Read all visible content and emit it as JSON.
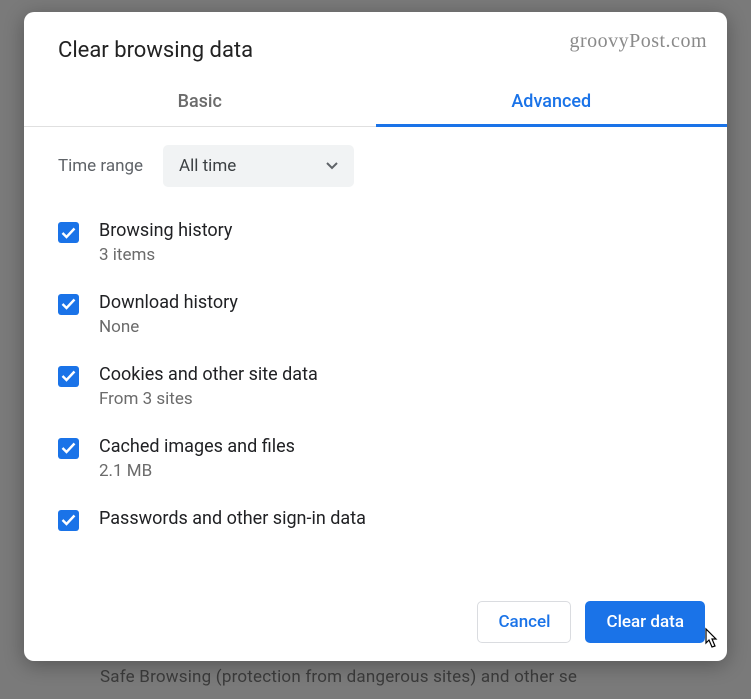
{
  "watermark": "groovyPost.com",
  "backdrop_text": "Safe Browsing (protection from dangerous sites) and other se",
  "dialog": {
    "title": "Clear browsing data",
    "tabs": {
      "basic": "Basic",
      "advanced": "Advanced",
      "active": "advanced"
    },
    "time_range": {
      "label": "Time range",
      "value": "All time"
    },
    "items": [
      {
        "title": "Browsing history",
        "subtitle": "3 items",
        "checked": true
      },
      {
        "title": "Download history",
        "subtitle": "None",
        "checked": true
      },
      {
        "title": "Cookies and other site data",
        "subtitle": "From 3 sites",
        "checked": true
      },
      {
        "title": "Cached images and files",
        "subtitle": "2.1 MB",
        "checked": true
      },
      {
        "title": "Passwords and other sign-in data",
        "subtitle": "",
        "checked": true
      }
    ],
    "buttons": {
      "cancel": "Cancel",
      "confirm": "Clear data"
    }
  },
  "colors": {
    "accent": "#1a73e8"
  }
}
